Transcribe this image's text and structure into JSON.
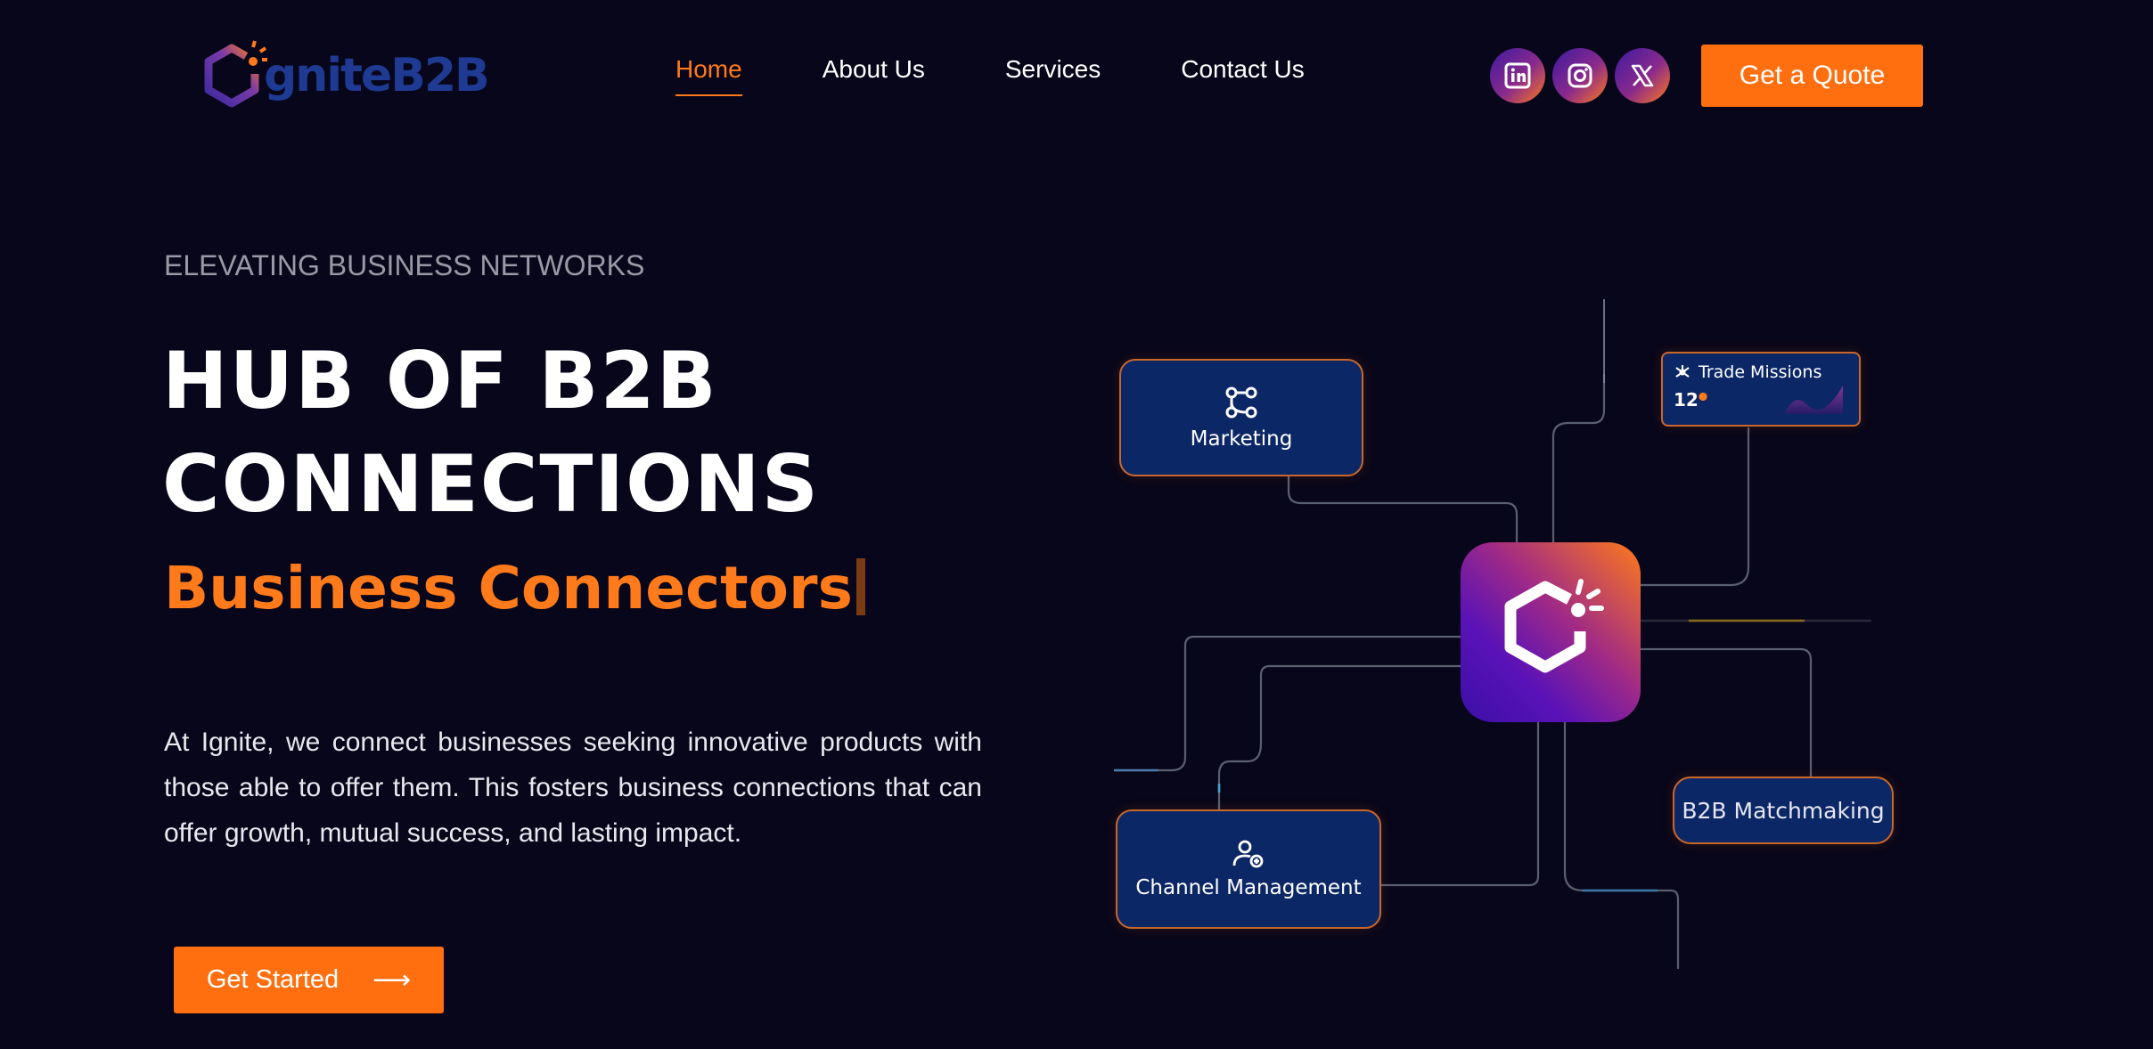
{
  "brand": {
    "name": "IgniteB2B",
    "logo_text": "gniteB2B",
    "colors": {
      "brand_blue": "#1f3a93",
      "accent_orange": "#ff7a1a"
    }
  },
  "nav": {
    "items": [
      {
        "label": "Home",
        "active": true
      },
      {
        "label": "About Us",
        "active": false
      },
      {
        "label": "Services",
        "active": false
      },
      {
        "label": "Contact Us",
        "active": false
      }
    ]
  },
  "socials": [
    {
      "icon": "linkedin-icon"
    },
    {
      "icon": "instagram-icon"
    },
    {
      "icon": "x-icon"
    }
  ],
  "header": {
    "quote_label": "Get a Quote"
  },
  "hero": {
    "eyebrow": "ELEVATING BUSINESS NETWORKS",
    "headline_line1": "HUB OF B2B",
    "headline_line2": "CONNECTIONS",
    "typed_text": "Business Connectors",
    "description": "At Ignite, we connect businesses seeking innovative products with those able to offer them. This fosters business connections that can offer growth, mutual success, and lasting impact.",
    "cta_label": "Get Started",
    "cta_icon": "arrow-right-icon"
  },
  "diagram": {
    "cards": {
      "marketing": {
        "label": "Marketing",
        "icon": "workflow-icon"
      },
      "channel": {
        "label": "Channel Management",
        "icon": "user-gear-icon"
      },
      "b2b": {
        "label": "B2B Matchmaking"
      },
      "trade": {
        "label": "Trade Missions",
        "count": "12",
        "icon": "network-icon"
      }
    },
    "hub_icon": "ignite-logo-icon"
  }
}
